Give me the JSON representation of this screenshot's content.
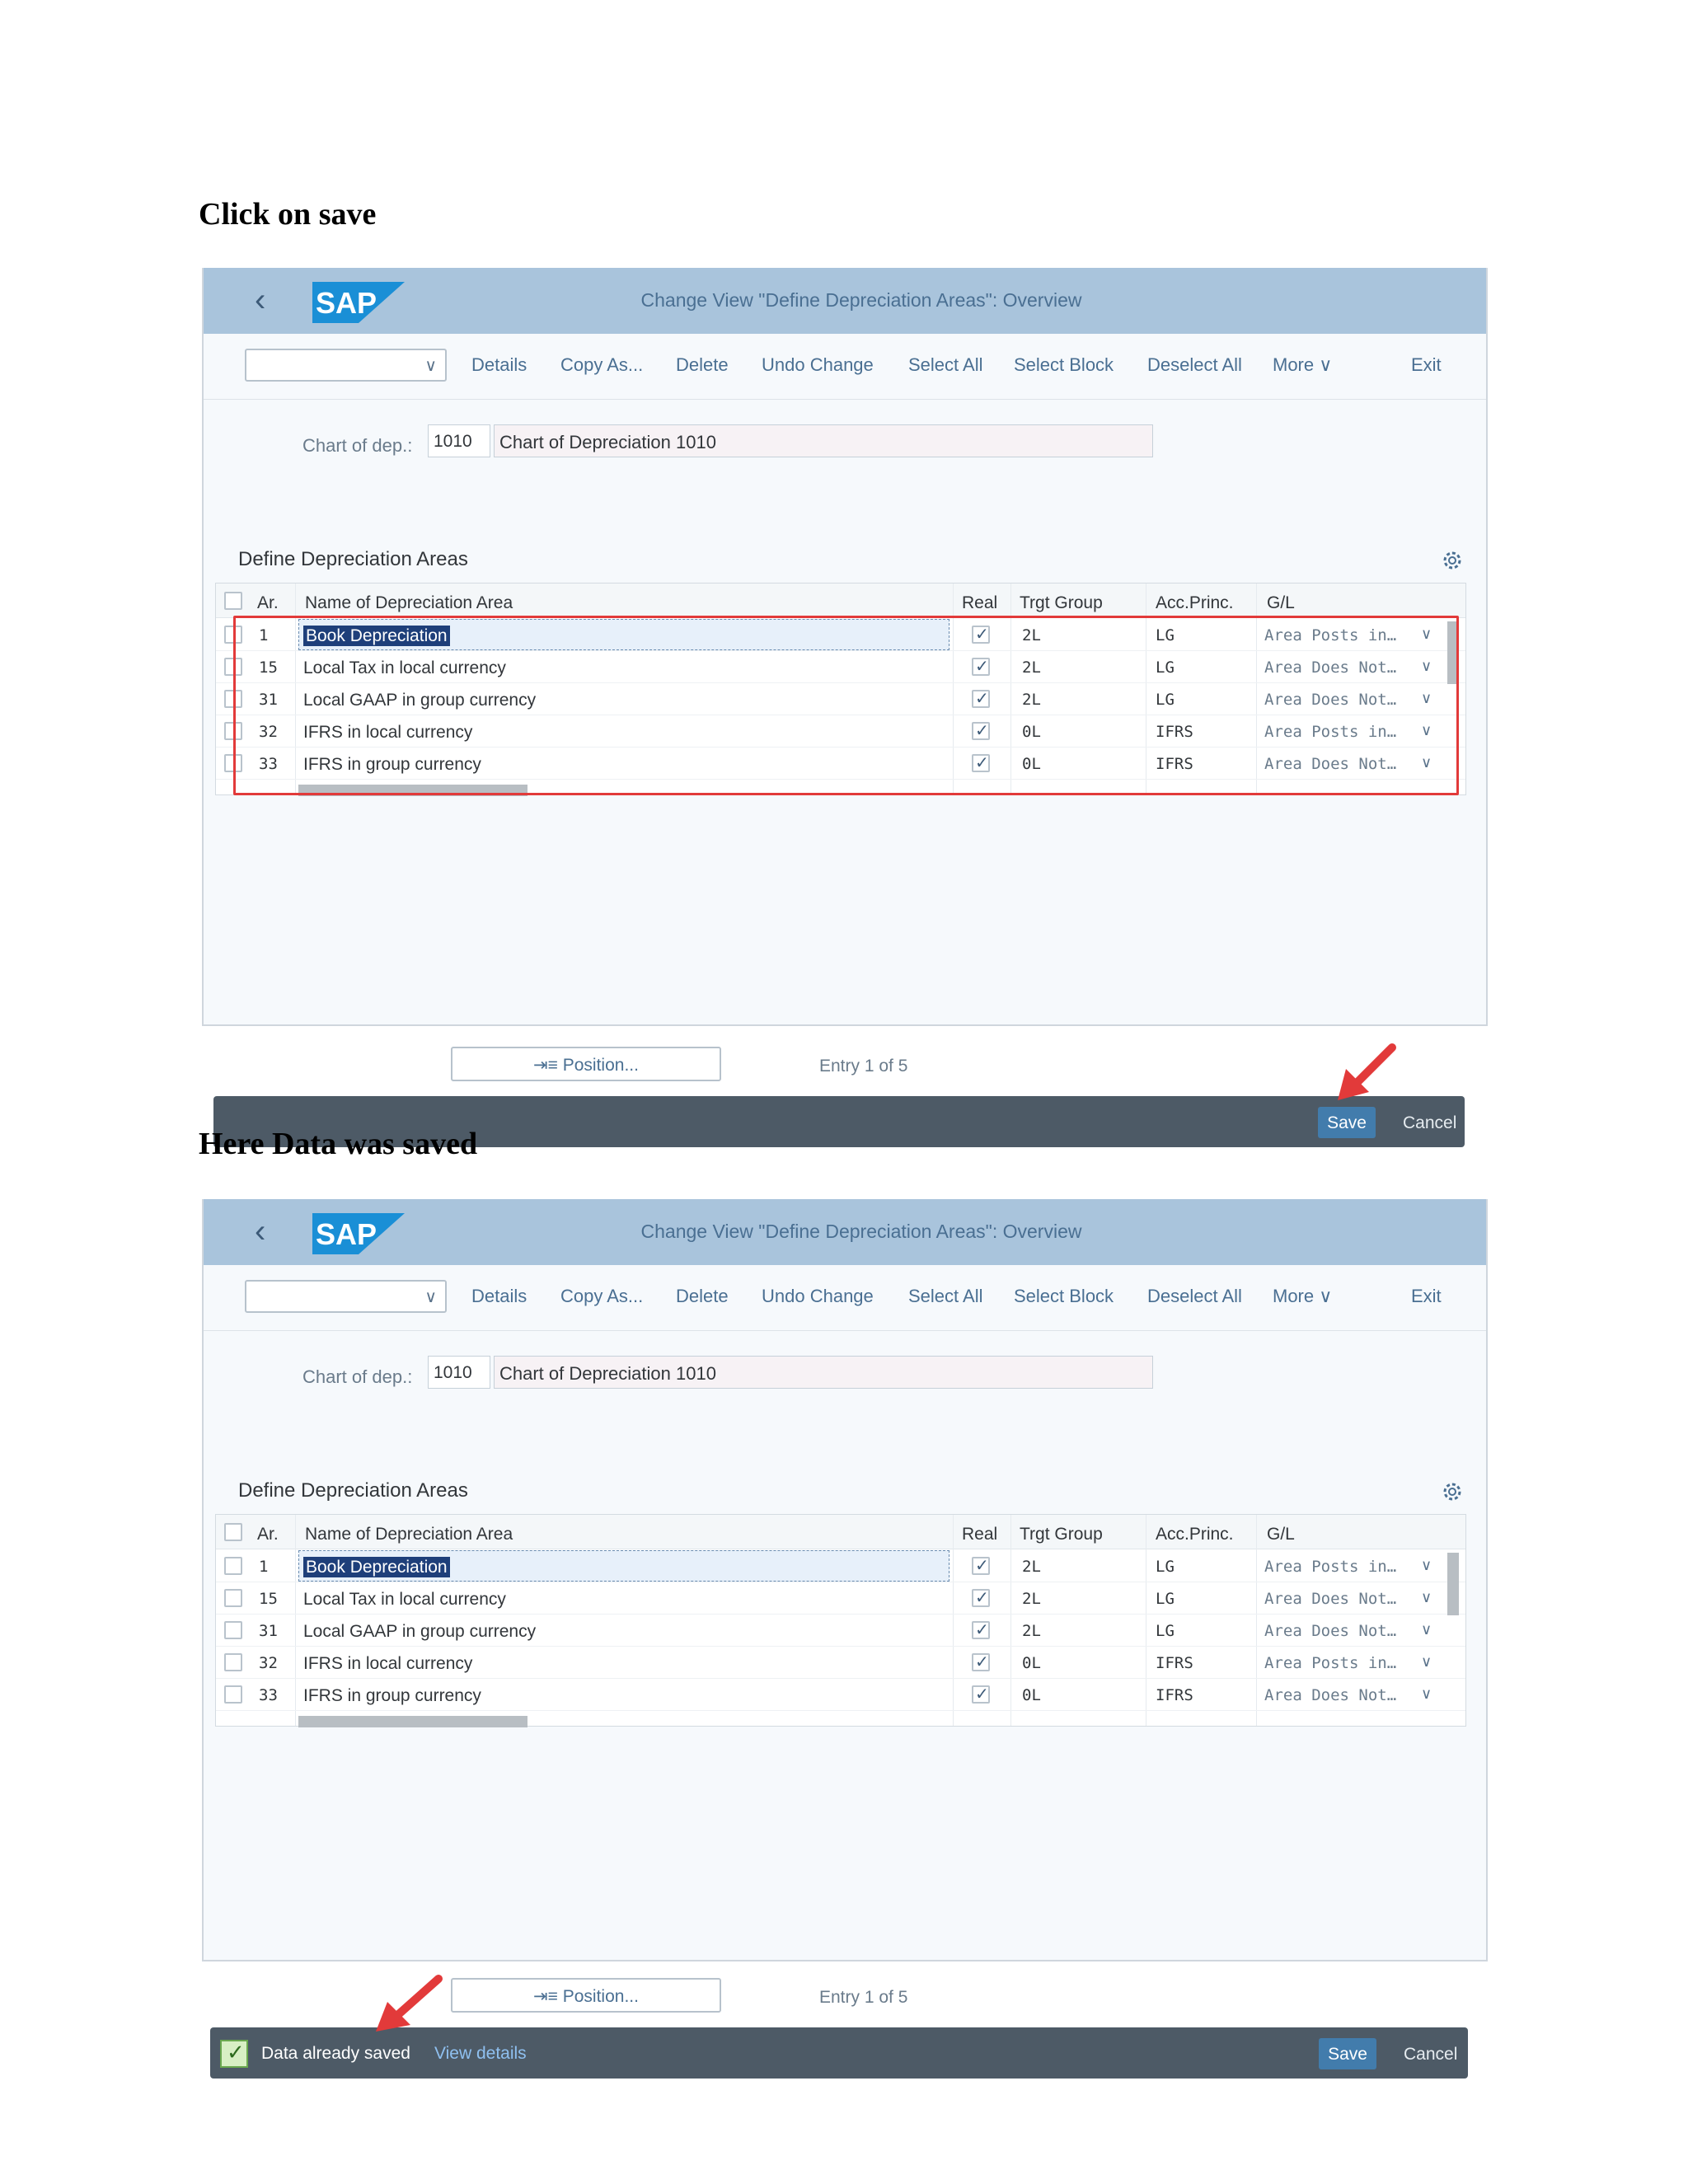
{
  "headings": {
    "first": "Click on save",
    "second": "Here Data was saved"
  },
  "app": {
    "logo_text": "SAP",
    "title": "Change View \"Define Depreciation Areas\": Overview",
    "toolbar": {
      "details": "Details",
      "copy_as": "Copy As...",
      "delete": "Delete",
      "undo_change": "Undo Change",
      "select_all": "Select All",
      "select_block": "Select Block",
      "deselect_all": "Deselect All",
      "more": "More",
      "exit": "Exit"
    },
    "chart": {
      "label": "Chart of dep.:",
      "code": "1010",
      "description": "Chart of Depreciation 1010"
    },
    "section_title": "Define Depreciation Areas",
    "columns": {
      "ar": "Ar.",
      "name": "Name of Depreciation Area",
      "real": "Real",
      "trgt_group": "Trgt Group",
      "acc_princ": "Acc.Princ.",
      "gl": "G/L"
    },
    "rows": [
      {
        "ar": "1",
        "name": "Book Depreciation",
        "real": true,
        "trgt": "2L",
        "acc": "LG",
        "gl": "Area Posts in…"
      },
      {
        "ar": "15",
        "name": "Local Tax in local currency",
        "real": true,
        "trgt": "2L",
        "acc": "LG",
        "gl": "Area Does Not…"
      },
      {
        "ar": "31",
        "name": "Local GAAP in group currency",
        "real": true,
        "trgt": "2L",
        "acc": "LG",
        "gl": "Area Does Not…"
      },
      {
        "ar": "32",
        "name": "IFRS in local currency",
        "real": true,
        "trgt": "0L",
        "acc": "IFRS",
        "gl": "Area Posts in…"
      },
      {
        "ar": "33",
        "name": "IFRS in group currency",
        "real": true,
        "trgt": "0L",
        "acc": "IFRS",
        "gl": "Area Does Not…"
      }
    ],
    "position_button": "Position...",
    "entry_text": "Entry 1 of 5",
    "save": "Save",
    "cancel": "Cancel",
    "message": "Data already saved",
    "view_details": "View details"
  },
  "colors": {
    "titlebar": "#a9c4dc",
    "footer": "#4d5a66",
    "save_button": "#427cac",
    "highlight": "#e23a3a"
  }
}
